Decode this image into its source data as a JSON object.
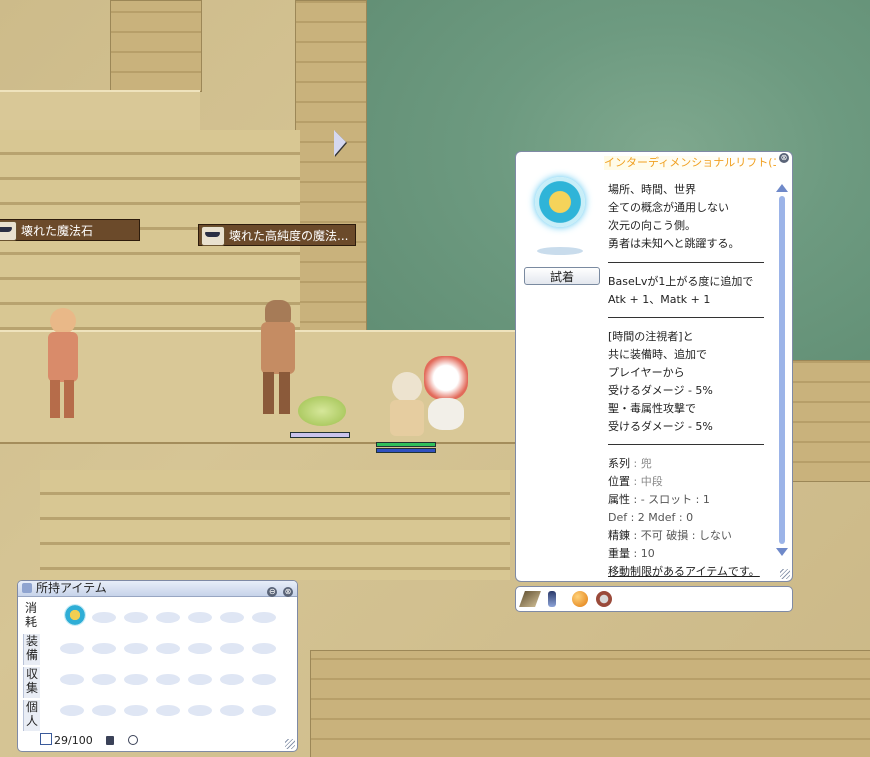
{
  "ground_items": [
    {
      "name": "壊れた魔法石"
    },
    {
      "name": "壊れた高純度の魔法..."
    }
  ],
  "tooltip": {
    "title": "インターディメンショナルリフト(エ",
    "try_on_label": "試着",
    "flavor": [
      "場所、時間、世界",
      "全ての概念が通用しない",
      "次元の向こう側。",
      "勇者は未知へと跳躍する。"
    ],
    "bonus1": [
      "BaseLvが1上がる度に追加で",
      "Atk + 1、Matk + 1"
    ],
    "bonus2": [
      "[時間の注視者]と",
      "共に装備時、追加で",
      "プレイヤーから",
      "受けるダメージ - 5%",
      "聖・毒属性攻撃で",
      "受けるダメージ - 5%"
    ],
    "stats": {
      "series_label": "系列",
      "series_value": "兜",
      "position_label": "位置",
      "position_value": "中段",
      "attribute_label": "属性",
      "attribute_value": "- スロット : 1",
      "def_line": "Def : 2 Mdef : 0",
      "refine_label": "精錬",
      "refine_value": "不可 破損 : しない",
      "weight_label": "重量",
      "weight_value": "10"
    },
    "restriction": "移動制限があるアイテムです。",
    "close_glyph": "⊗"
  },
  "inventory": {
    "title": "所持アイテム",
    "tabs": [
      "消耗",
      "装備",
      "収集",
      "個人"
    ],
    "count": "29/100",
    "min_glyph": "⊖",
    "close_glyph": "⊗"
  },
  "colors": {
    "title_orange": "#f0a020",
    "label_brown": "#6b4a2a",
    "hp_green": "#2fbf5a",
    "sp_blue": "#3050c0"
  }
}
